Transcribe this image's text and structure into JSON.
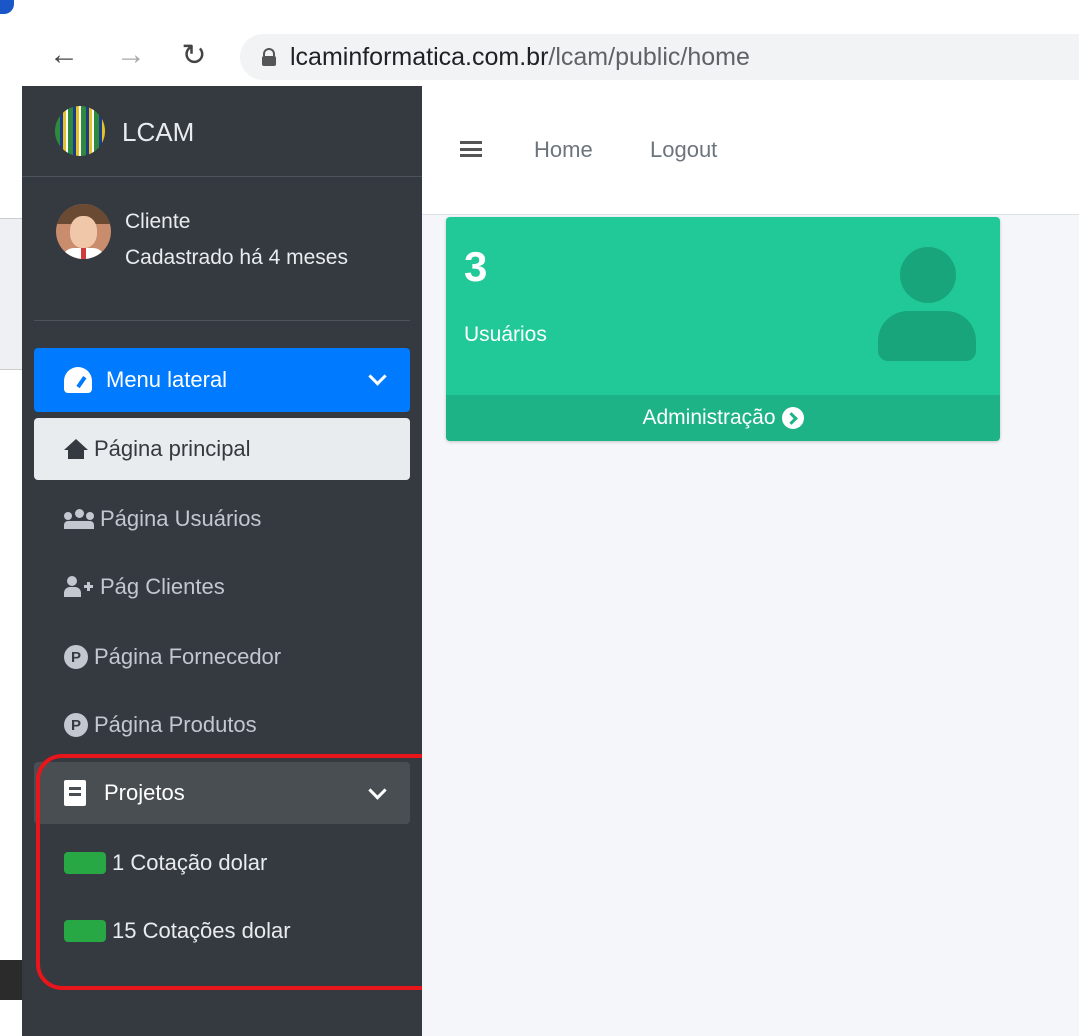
{
  "browser": {
    "url_host": "lcaminformatica.com.br",
    "url_path": "/lcam/public/home"
  },
  "sidebar": {
    "brand_name": "LCAM",
    "user": {
      "name": "Cliente",
      "since": "Cadastrado há 4 meses"
    },
    "items": [
      {
        "label": "Menu lateral",
        "icon": "tachometer-icon"
      },
      {
        "label": "Página principal",
        "icon": "home-icon"
      },
      {
        "label": "Página Usuários",
        "icon": "users-icon"
      },
      {
        "label": "Pág Clientes",
        "icon": "user-plus-icon"
      },
      {
        "label": "Página Fornecedor",
        "icon": "p-circle-icon"
      },
      {
        "label": "Página Produtos",
        "icon": "p-circle-icon"
      },
      {
        "label": "Projetos",
        "icon": "book-icon"
      },
      {
        "label": "1 Cotação dolar",
        "icon": "green-badge-icon"
      },
      {
        "label": "15 Cotações dolar",
        "icon": "green-badge-icon"
      }
    ],
    "p_glyph": "P"
  },
  "navbar": {
    "home": "Home",
    "logout": "Logout"
  },
  "small_box": {
    "count": "3",
    "label": "Usuários",
    "footer": "Administração",
    "color": "#20c997"
  },
  "colors": {
    "sidebar_bg": "#343a40",
    "primary": "#007bff",
    "highlight": "#e8151b"
  }
}
